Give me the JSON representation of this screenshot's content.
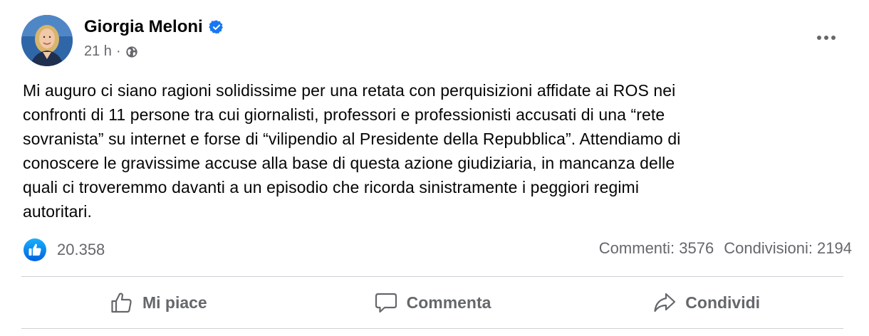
{
  "post": {
    "author": "Giorgia Meloni",
    "verified_icon": "verified-badge-icon",
    "time": "21 h",
    "separator": "·",
    "audience_icon": "globe-icon",
    "text_lines": [
      "Mi auguro ci siano ragioni solidissime per una retata con perquisizioni affidate ai ROS nei",
      "confronti di 11 persone tra cui giornalisti, professori e professionisti accusati di una “rete",
      "sovranista” su internet e forse di “vilipendio al Presidente della Repubblica”. Attendiamo di",
      "conoscere le gravissime accuse alla base di questa azione giudiziaria, in mancanza delle",
      "quali ci troveremmo davanti a un episodio che ricorda sinistramente i peggiori regimi",
      "autoritari."
    ]
  },
  "stats": {
    "likes": "20.358",
    "comments": "Commenti: 3576",
    "shares": "Condivisioni: 2194"
  },
  "actions": {
    "like": "Mi piace",
    "comment": "Commenta",
    "share": "Condividi"
  },
  "colors": {
    "accent": "#1877f2",
    "secondary_text": "#65676b",
    "primary_text": "#050505",
    "divider": "#ced0d4"
  }
}
